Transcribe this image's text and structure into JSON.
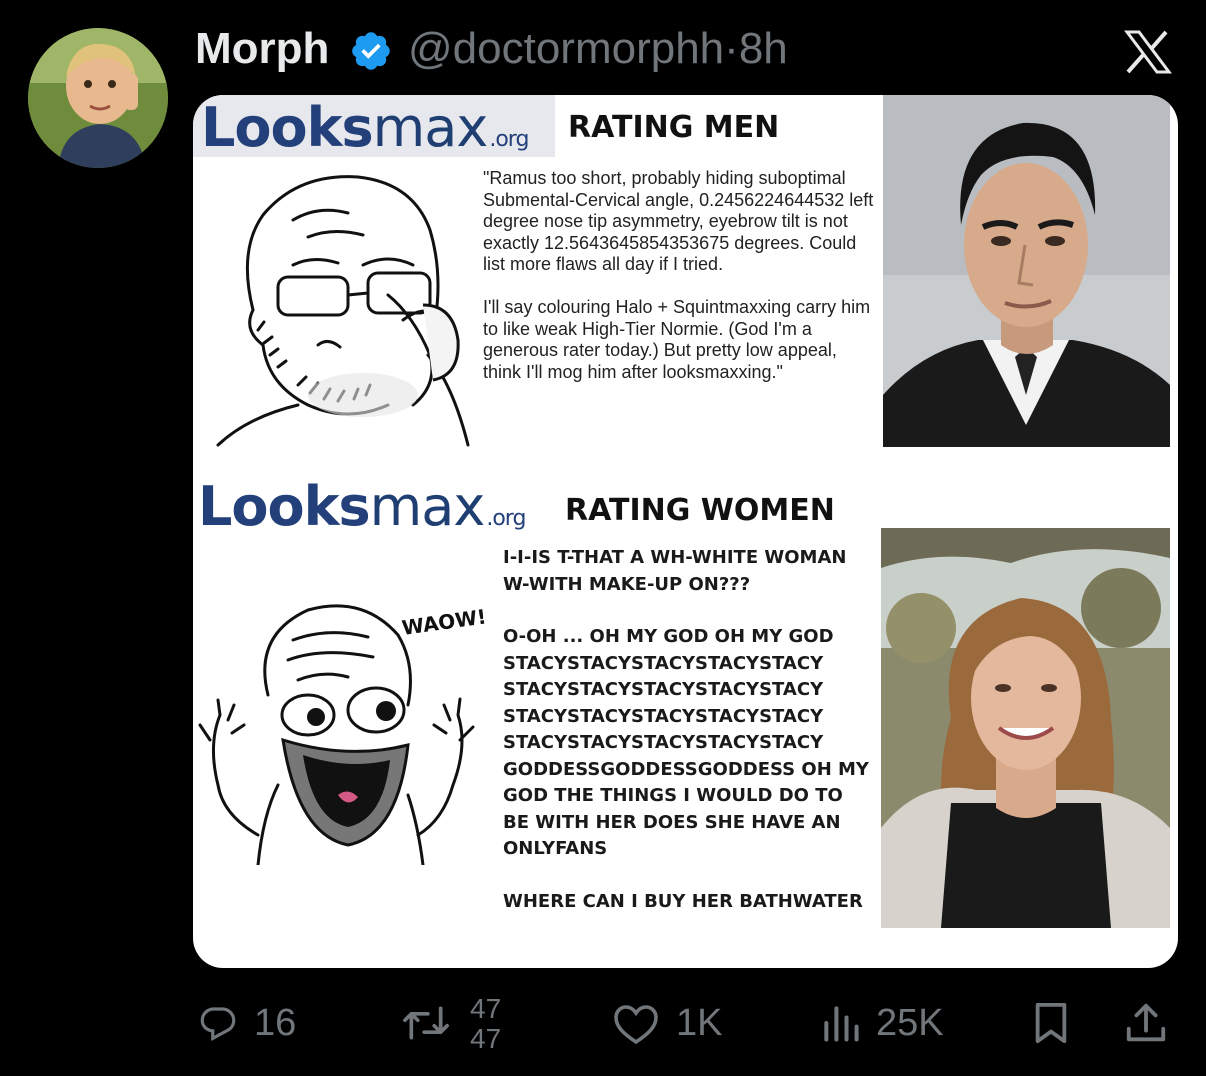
{
  "tweet": {
    "author_name": "Morph",
    "handle": "@doctormorphh",
    "separator": "·",
    "time": "8h",
    "verified": true,
    "icons": {
      "verified": "verified-badge-icon",
      "platform": "x-logo-icon"
    },
    "accent_color": "#1d9bf0"
  },
  "media": {
    "top_panel": {
      "logo_bold": "Looks",
      "logo_rest": "max",
      "logo_domain": ".org",
      "heading": "RATING MEN",
      "quote_paragraph_1": "\"Ramus too short, probably hiding suboptimal Submental-Cervical angle, 0.2456224644532 left degree nose tip asymmetry, eyebrow tilt is not exactly 12.5643645854353675 degrees. Could list more flaws all day if I tried.",
      "quote_paragraph_2": "I'll say colouring Halo + Squintmaxxing carry him to like weak High-Tier Normie. (God I'm a generous rater today.) But pretty low appeal, think I'll mog him after looksmaxxing.\""
    },
    "bottom_panel": {
      "logo_bold": "Looks",
      "logo_rest": "max",
      "logo_domain": ".org",
      "heading": "RATING WOMEN",
      "wojak_caption": "WAOW!",
      "shout_paragraph_1": "I-I-IS T-THAT A WH-WHITE WOMAN W-WITH MAKE-UP ON???",
      "shout_paragraph_2": "O-OH ... OH MY GOD OH MY GOD STACYSTACYSTACYSTACYSTACY STACYSTACYSTACYSTACYSTACY STACYSTACYSTACYSTACYSTACY STACYSTACYSTACYSTACYSTACY GODDESSGODDESSGODDESS OH MY GOD THE THINGS I WOULD DO TO BE WITH HER DOES SHE HAVE AN ONLYFANS",
      "shout_paragraph_3": "WHERE CAN I BUY HER BATHWATER"
    }
  },
  "actions": {
    "reply": {
      "icon": "reply-icon",
      "count": "16"
    },
    "repost": {
      "icon": "repost-icon",
      "count": "47",
      "count_next": "47"
    },
    "like": {
      "icon": "heart-icon",
      "count": "1K"
    },
    "views": {
      "icon": "views-chart-icon",
      "count": "25K"
    },
    "bookmark": {
      "icon": "bookmark-icon"
    },
    "share": {
      "icon": "share-icon"
    }
  }
}
